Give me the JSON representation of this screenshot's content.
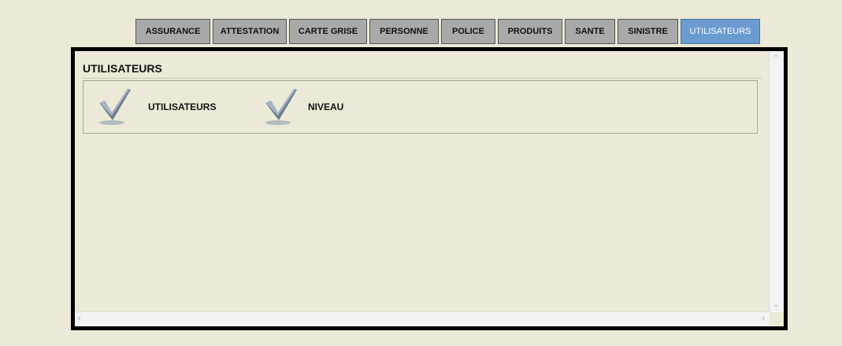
{
  "tabs": [
    {
      "label": "ASSURANCE"
    },
    {
      "label": "ATTESTATION"
    },
    {
      "label": "CARTE GRISE"
    },
    {
      "label": "PERSONNE"
    },
    {
      "label": "POLICE"
    },
    {
      "label": "PRODUITS"
    },
    {
      "label": "SANTE"
    },
    {
      "label": "SINISTRE"
    },
    {
      "label": "UTILISATEURS",
      "active": true
    }
  ],
  "panel": {
    "title": "UTILISATEURS",
    "items": [
      {
        "label": "UTILISATEURS",
        "icon": "checkmark-icon"
      },
      {
        "label": "NIVEAU",
        "icon": "checkmark-icon"
      }
    ]
  },
  "colors": {
    "background": "#ece9d8",
    "tab": "#a9a9a9",
    "tab_active": "#6b9bd1",
    "panel_border": "#000000"
  }
}
